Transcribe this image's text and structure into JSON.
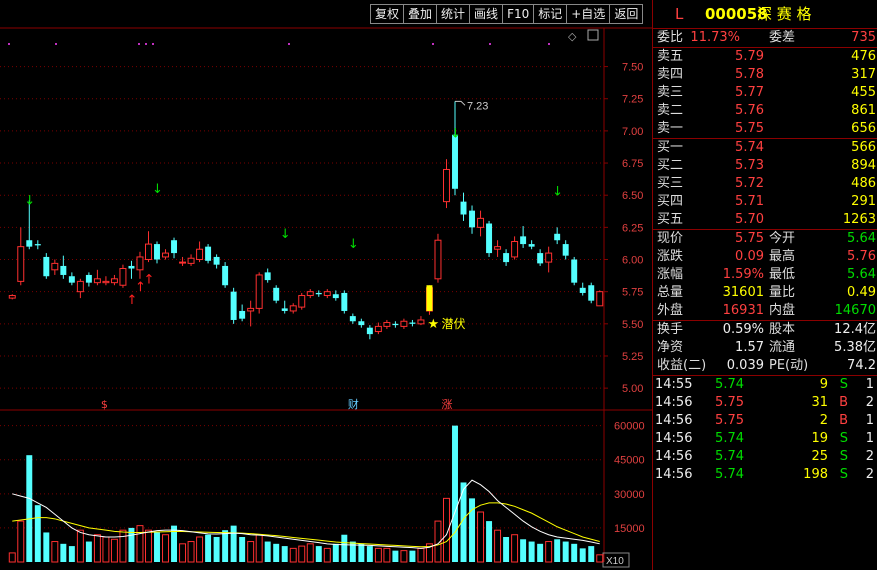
{
  "toolbar": {
    "buttons": [
      "复权",
      "叠加",
      "统计",
      "画线",
      "F10",
      "标记",
      "+自选",
      "返回"
    ]
  },
  "stock": {
    "flag": "L",
    "code": "000058",
    "name": "深 赛 格"
  },
  "weibi": {
    "label1": "委比",
    "value1": "11.73%",
    "label2": "委差",
    "value2": "735"
  },
  "asks": [
    {
      "label": "卖五",
      "price": "5.79",
      "vol": "476"
    },
    {
      "label": "卖四",
      "price": "5.78",
      "vol": "317"
    },
    {
      "label": "卖三",
      "price": "5.77",
      "vol": "455"
    },
    {
      "label": "卖二",
      "price": "5.76",
      "vol": "861"
    },
    {
      "label": "卖一",
      "price": "5.75",
      "vol": "656"
    }
  ],
  "bids": [
    {
      "label": "买一",
      "price": "5.74",
      "vol": "566"
    },
    {
      "label": "买二",
      "price": "5.73",
      "vol": "894"
    },
    {
      "label": "买三",
      "price": "5.72",
      "vol": "486"
    },
    {
      "label": "买四",
      "price": "5.71",
      "vol": "291"
    },
    {
      "label": "买五",
      "price": "5.70",
      "vol": "1263"
    }
  ],
  "quote": [
    {
      "l1": "现价",
      "v1": "5.75",
      "c1": "red",
      "l2": "今开",
      "v2": "5.64",
      "c2": "grn"
    },
    {
      "l1": "涨跌",
      "v1": "0.09",
      "c1": "red",
      "l2": "最高",
      "v2": "5.76",
      "c2": "red"
    },
    {
      "l1": "涨幅",
      "v1": "1.59%",
      "c1": "red",
      "l2": "最低",
      "v2": "5.64",
      "c2": "grn"
    },
    {
      "l1": "总量",
      "v1": "31601",
      "c1": "yel",
      "l2": "量比",
      "v2": "0.49",
      "c2": "yel"
    },
    {
      "l1": "外盘",
      "v1": "16931",
      "c1": "red",
      "l2": "内盘",
      "v2": "14670",
      "c2": "grn"
    }
  ],
  "fundamentals": [
    {
      "l1": "换手",
      "v1": "0.59%",
      "l2": "股本",
      "v2": "12.4亿"
    },
    {
      "l1": "净资",
      "v1": "1.57",
      "l2": "流通",
      "v2": "5.38亿"
    },
    {
      "l1": "收益(二)",
      "v1": "0.039",
      "l2": "PE(动)",
      "v2": "74.2"
    }
  ],
  "ticks": [
    {
      "time": "14:55",
      "price": "5.74",
      "pc": "grn",
      "vol": "9",
      "side": "S",
      "sc": "grn",
      "n": "1"
    },
    {
      "time": "14:56",
      "price": "5.75",
      "pc": "red",
      "vol": "31",
      "side": "B",
      "sc": "red",
      "n": "2"
    },
    {
      "time": "14:56",
      "price": "5.75",
      "pc": "red",
      "vol": "2",
      "side": "B",
      "sc": "red",
      "n": "1"
    },
    {
      "time": "14:56",
      "price": "5.74",
      "pc": "grn",
      "vol": "19",
      "side": "S",
      "sc": "grn",
      "n": "1"
    },
    {
      "time": "14:56",
      "price": "5.74",
      "pc": "grn",
      "vol": "25",
      "side": "S",
      "sc": "grn",
      "n": "2"
    },
    {
      "time": "14:56",
      "price": "5.74",
      "pc": "grn",
      "vol": "198",
      "side": "S",
      "sc": "grn",
      "n": "2"
    }
  ],
  "chart_data": {
    "type": "candlestick",
    "price_axis": {
      "ticks": [
        "7.50",
        "7.25",
        "7.00",
        "6.75",
        "6.50",
        "6.25",
        "6.00",
        "5.75",
        "5.50",
        "5.25",
        "5.00"
      ],
      "ylim": [
        4.83,
        7.8
      ]
    },
    "volume_axis": {
      "ticks": [
        "60000",
        "45000",
        "30000",
        "15000"
      ],
      "ylim": [
        0,
        66000
      ],
      "unit_label": "X10"
    },
    "high_label": "7.23",
    "annotation": "潜伏",
    "event_markers": [
      "$",
      "财",
      "涨"
    ],
    "candles": [
      {
        "o": 5.7,
        "c": 5.72,
        "h": 5.73,
        "l": 5.69,
        "v": 4000
      },
      {
        "o": 5.83,
        "c": 6.1,
        "h": 6.25,
        "l": 5.8,
        "v": 18000
      },
      {
        "o": 6.15,
        "c": 6.1,
        "h": 6.46,
        "l": 6.08,
        "v": 47000
      },
      {
        "o": 6.12,
        "c": 6.11,
        "h": 6.15,
        "l": 6.08,
        "v": 25000
      },
      {
        "o": 6.02,
        "c": 5.87,
        "h": 6.05,
        "l": 5.85,
        "v": 13000
      },
      {
        "o": 5.92,
        "c": 5.97,
        "h": 6.0,
        "l": 5.88,
        "v": 9000
      },
      {
        "o": 5.95,
        "c": 5.88,
        "h": 6.03,
        "l": 5.85,
        "v": 8000
      },
      {
        "o": 5.87,
        "c": 5.82,
        "h": 5.9,
        "l": 5.8,
        "v": 7000
      },
      {
        "o": 5.75,
        "c": 5.83,
        "h": 5.85,
        "l": 5.7,
        "v": 14000
      },
      {
        "o": 5.88,
        "c": 5.82,
        "h": 5.9,
        "l": 5.79,
        "v": 9000
      },
      {
        "o": 5.82,
        "c": 5.85,
        "h": 5.92,
        "l": 5.8,
        "v": 12000
      },
      {
        "o": 5.82,
        "c": 5.83,
        "h": 5.87,
        "l": 5.8,
        "v": 11000
      },
      {
        "o": 5.82,
        "c": 5.85,
        "h": 5.88,
        "l": 5.8,
        "v": 10000
      },
      {
        "o": 5.8,
        "c": 5.93,
        "h": 5.96,
        "l": 5.78,
        "v": 14000
      },
      {
        "o": 5.95,
        "c": 5.93,
        "h": 5.99,
        "l": 5.85,
        "v": 15000
      },
      {
        "o": 5.92,
        "c": 6.02,
        "h": 6.06,
        "l": 5.85,
        "v": 16000
      },
      {
        "o": 6.0,
        "c": 6.12,
        "h": 6.22,
        "l": 5.98,
        "v": 14000
      },
      {
        "o": 6.12,
        "c": 6.0,
        "h": 6.14,
        "l": 5.97,
        "v": 13000
      },
      {
        "o": 6.02,
        "c": 6.05,
        "h": 6.08,
        "l": 6.0,
        "v": 12000
      },
      {
        "o": 6.15,
        "c": 6.05,
        "h": 6.17,
        "l": 6.01,
        "v": 16000
      },
      {
        "o": 5.98,
        "c": 5.98,
        "h": 6.02,
        "l": 5.95,
        "v": 8000
      },
      {
        "o": 5.97,
        "c": 6.01,
        "h": 6.04,
        "l": 5.95,
        "v": 9000
      },
      {
        "o": 6.0,
        "c": 6.08,
        "h": 6.14,
        "l": 5.98,
        "v": 11000
      },
      {
        "o": 6.1,
        "c": 5.99,
        "h": 6.12,
        "l": 5.97,
        "v": 12000
      },
      {
        "o": 6.02,
        "c": 5.96,
        "h": 6.04,
        "l": 5.93,
        "v": 11000
      },
      {
        "o": 5.95,
        "c": 5.8,
        "h": 5.98,
        "l": 5.78,
        "v": 14000
      },
      {
        "o": 5.75,
        "c": 5.53,
        "h": 5.78,
        "l": 5.5,
        "v": 16000
      },
      {
        "o": 5.6,
        "c": 5.54,
        "h": 5.65,
        "l": 5.52,
        "v": 11000
      },
      {
        "o": 5.6,
        "c": 5.62,
        "h": 5.68,
        "l": 5.48,
        "v": 9000
      },
      {
        "o": 5.62,
        "c": 5.88,
        "h": 5.9,
        "l": 5.58,
        "v": 12000
      },
      {
        "o": 5.9,
        "c": 5.84,
        "h": 5.93,
        "l": 5.82,
        "v": 9000
      },
      {
        "o": 5.78,
        "c": 5.68,
        "h": 5.8,
        "l": 5.66,
        "v": 8000
      },
      {
        "o": 5.62,
        "c": 5.6,
        "h": 5.68,
        "l": 5.58,
        "v": 7000
      },
      {
        "o": 5.6,
        "c": 5.64,
        "h": 5.66,
        "l": 5.58,
        "v": 6000
      },
      {
        "o": 5.63,
        "c": 5.72,
        "h": 5.74,
        "l": 5.61,
        "v": 7000
      },
      {
        "o": 5.72,
        "c": 5.75,
        "h": 5.77,
        "l": 5.7,
        "v": 8000
      },
      {
        "o": 5.74,
        "c": 5.73,
        "h": 5.76,
        "l": 5.71,
        "v": 7000
      },
      {
        "o": 5.72,
        "c": 5.75,
        "h": 5.77,
        "l": 5.7,
        "v": 6000
      },
      {
        "o": 5.73,
        "c": 5.7,
        "h": 5.76,
        "l": 5.68,
        "v": 8000
      },
      {
        "o": 5.74,
        "c": 5.6,
        "h": 5.76,
        "l": 5.58,
        "v": 12000
      },
      {
        "o": 5.56,
        "c": 5.52,
        "h": 5.58,
        "l": 5.5,
        "v": 9000
      },
      {
        "o": 5.52,
        "c": 5.49,
        "h": 5.54,
        "l": 5.47,
        "v": 8000
      },
      {
        "o": 5.47,
        "c": 5.42,
        "h": 5.49,
        "l": 5.38,
        "v": 7000
      },
      {
        "o": 5.44,
        "c": 5.48,
        "h": 5.51,
        "l": 5.42,
        "v": 6000
      },
      {
        "o": 5.48,
        "c": 5.51,
        "h": 5.53,
        "l": 5.46,
        "v": 6000
      },
      {
        "o": 5.5,
        "c": 5.49,
        "h": 5.52,
        "l": 5.47,
        "v": 5000
      },
      {
        "o": 5.48,
        "c": 5.52,
        "h": 5.54,
        "l": 5.46,
        "v": 5000
      },
      {
        "o": 5.51,
        "c": 5.5,
        "h": 5.53,
        "l": 5.48,
        "v": 5000
      },
      {
        "o": 5.5,
        "c": 5.53,
        "h": 5.56,
        "l": 5.49,
        "v": 6000
      },
      {
        "o": 5.6,
        "c": 5.78,
        "h": 5.8,
        "l": 5.57,
        "v": 8000
      },
      {
        "o": 5.85,
        "c": 6.15,
        "h": 6.2,
        "l": 5.82,
        "v": 18000
      },
      {
        "o": 6.45,
        "c": 6.7,
        "h": 6.78,
        "l": 6.4,
        "v": 28000
      },
      {
        "o": 6.97,
        "c": 6.55,
        "h": 7.23,
        "l": 6.5,
        "v": 60000
      },
      {
        "o": 6.45,
        "c": 6.35,
        "h": 6.52,
        "l": 6.3,
        "v": 35000
      },
      {
        "o": 6.38,
        "c": 6.25,
        "h": 6.42,
        "l": 6.2,
        "v": 28000
      },
      {
        "o": 6.25,
        "c": 6.32,
        "h": 6.38,
        "l": 6.18,
        "v": 22000
      },
      {
        "o": 6.28,
        "c": 6.05,
        "h": 6.3,
        "l": 6.02,
        "v": 18000
      },
      {
        "o": 6.08,
        "c": 6.1,
        "h": 6.15,
        "l": 6.02,
        "v": 14000
      },
      {
        "o": 6.05,
        "c": 5.98,
        "h": 6.08,
        "l": 5.95,
        "v": 11000
      },
      {
        "o": 6.02,
        "c": 6.14,
        "h": 6.18,
        "l": 6.0,
        "v": 12000
      },
      {
        "o": 6.18,
        "c": 6.12,
        "h": 6.26,
        "l": 6.09,
        "v": 10000
      },
      {
        "o": 6.12,
        "c": 6.1,
        "h": 6.15,
        "l": 6.08,
        "v": 9000
      },
      {
        "o": 6.05,
        "c": 5.97,
        "h": 6.08,
        "l": 5.95,
        "v": 8000
      },
      {
        "o": 5.98,
        "c": 6.05,
        "h": 6.1,
        "l": 5.9,
        "v": 9000
      },
      {
        "o": 6.2,
        "c": 6.15,
        "h": 6.25,
        "l": 6.12,
        "v": 10000
      },
      {
        "o": 6.12,
        "c": 6.03,
        "h": 6.15,
        "l": 6.0,
        "v": 9000
      },
      {
        "o": 6.0,
        "c": 5.82,
        "h": 6.02,
        "l": 5.8,
        "v": 8000
      },
      {
        "o": 5.78,
        "c": 5.74,
        "h": 5.82,
        "l": 5.72,
        "v": 6000
      },
      {
        "o": 5.8,
        "c": 5.68,
        "h": 5.82,
        "l": 5.66,
        "v": 7000
      },
      {
        "o": 5.64,
        "c": 5.75,
        "h": 5.76,
        "l": 5.64,
        "v": 3160
      }
    ],
    "ma_volume_white": [
      30000,
      29000,
      28000,
      26000,
      24000,
      21000,
      18000,
      15000,
      13000,
      12000,
      11500,
      11000,
      11000,
      11200,
      11800,
      12500,
      13200,
      13800,
      14000,
      14000,
      13800,
      13300,
      12800,
      12400,
      12300,
      12500,
      12700,
      12500,
      12000,
      11800,
      11500,
      11000,
      10500,
      10000,
      9500,
      9000,
      8500,
      8000,
      7700,
      7600,
      7500,
      7400,
      7300,
      7100,
      6900,
      6700,
      6500,
      6300,
      6000,
      6500,
      8000,
      12000,
      22000,
      32000,
      36000,
      34000,
      31000,
      27000,
      24000,
      21000,
      18000,
      15500,
      13500,
      12000,
      11000,
      10500,
      10000,
      9500,
      8800,
      8000
    ],
    "ma_volume_yellow": [
      18000,
      18500,
      19000,
      19500,
      19500,
      19000,
      18000,
      17000,
      16000,
      15000,
      14500,
      14000,
      13500,
      13200,
      13000,
      13000,
      13100,
      13200,
      13300,
      13400,
      13400,
      13300,
      13200,
      13100,
      13000,
      12900,
      12800,
      12700,
      12500,
      12200,
      11900,
      11600,
      11200,
      10800,
      10400,
      10000,
      9600,
      9200,
      8800,
      8500,
      8300,
      8100,
      7900,
      7700,
      7500,
      7300,
      7100,
      6900,
      6700,
      6800,
      7500,
      9000,
      13000,
      19000,
      23000,
      25000,
      26000,
      26000,
      25500,
      24500,
      23000,
      21500,
      19500,
      17500,
      15500,
      14000,
      12500,
      11000,
      10000,
      9000
    ]
  }
}
